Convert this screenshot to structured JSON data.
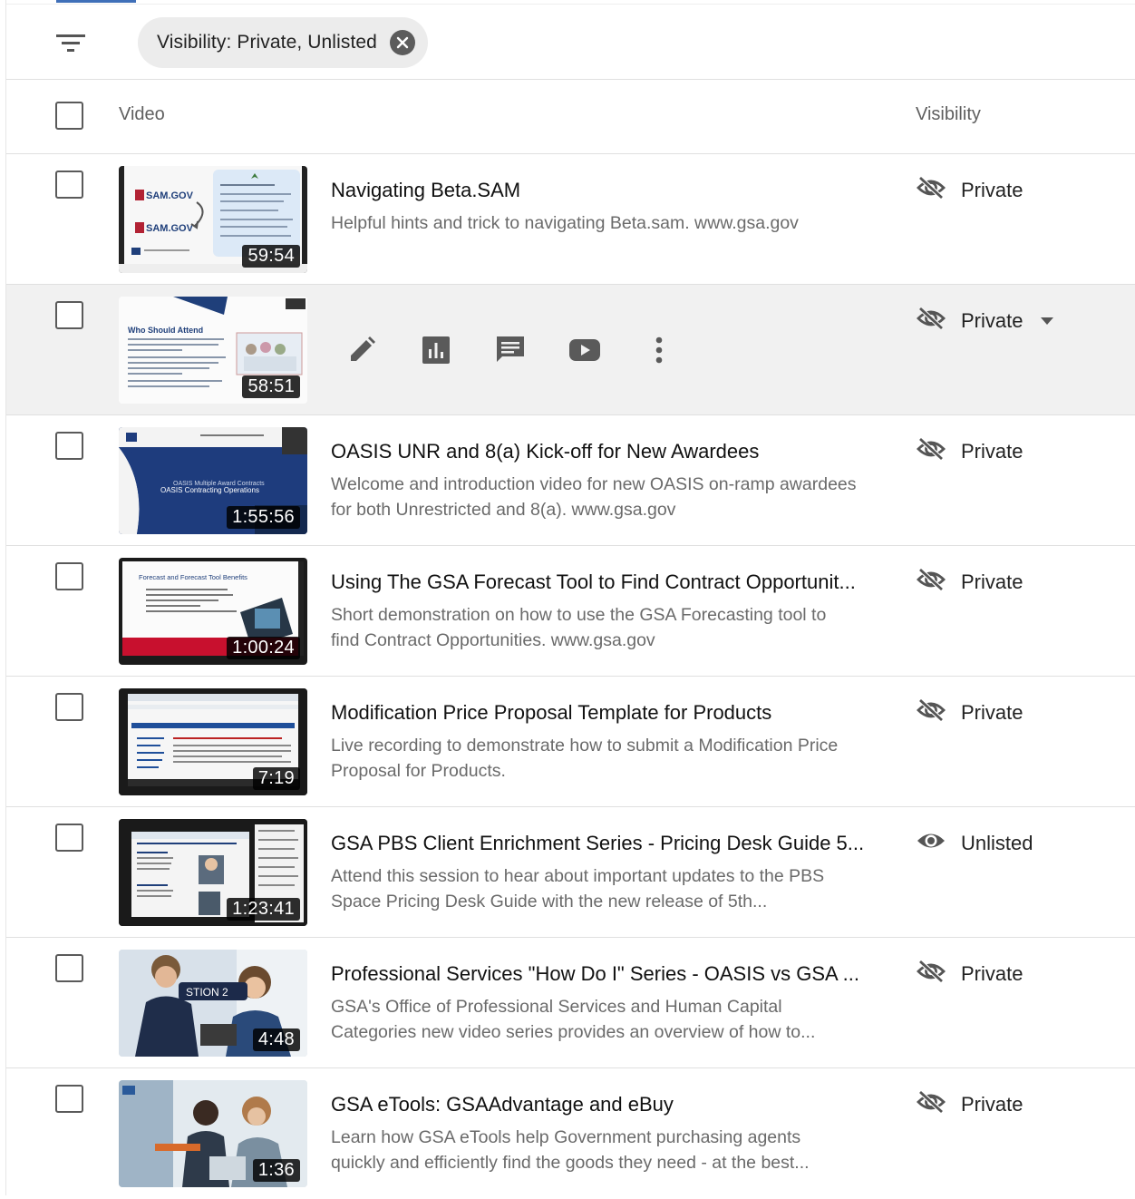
{
  "filter": {
    "chip_label": "Visibility: Private, Unlisted"
  },
  "header": {
    "video_col": "Video",
    "visibility_col": "Visibility"
  },
  "rows": [
    {
      "title": "Navigating Beta.SAM",
      "description": "Helpful hints and trick to navigating Beta.sam. www.gsa.gov",
      "duration": "59:54",
      "visibility": "Private",
      "thumb_text": [
        "SAM.GOV",
        "SAM.GOV"
      ]
    },
    {
      "title": "",
      "description": "",
      "duration": "58:51",
      "visibility": "Private",
      "thumb_text": [
        "Who Should Attend"
      ]
    },
    {
      "title": "OASIS UNR and 8(a) Kick-off for New Awardees",
      "description": "Welcome and introduction video for new OASIS on-ramp awardees for both Unrestricted and 8(a). www.gsa.gov",
      "duration": "1:55:56",
      "visibility": "Private",
      "thumb_text": [
        "OASIS Contracting Operations"
      ]
    },
    {
      "title": "Using The GSA Forecast Tool to Find Contract Opportunit...",
      "description": "Short demonstration on how to use the GSA Forecasting tool to find Contract Opportunities. www.gsa.gov",
      "duration": "1:00:24",
      "visibility": "Private",
      "thumb_text": [
        "Forecast and Forecast Tool Benefits"
      ]
    },
    {
      "title": "Modification Price Proposal Template for Products",
      "description": "Live recording to demonstrate how to submit a Modification Price Proposal for Products.",
      "duration": "7:19",
      "visibility": "Private",
      "thumb_text": []
    },
    {
      "title": "GSA PBS Client Enrichment Series - Pricing Desk Guide 5...",
      "description": "Attend this session to hear about important updates to the PBS Space Pricing Desk Guide with the new release of 5th...",
      "duration": "1:23:41",
      "visibility": "Unlisted",
      "thumb_text": []
    },
    {
      "title": "Professional Services \"How Do I\" Series - OASIS vs GSA ...",
      "description": "GSA's Office of Professional Services and Human Capital Categories new video series provides an overview of how to...",
      "duration": "4:48",
      "visibility": "Private",
      "thumb_text": [
        "STION 2"
      ]
    },
    {
      "title": "GSA eTools: GSAAdvantage and eBuy",
      "description": "Learn how GSA eTools help Government purchasing agents quickly and efficiently find the goods they need - at the best...",
      "duration": "1:36",
      "visibility": "Private",
      "thumb_text": []
    }
  ],
  "icons": {
    "filter": "filter-list-icon",
    "chip_close": "close-circle-icon",
    "private": "visibility-off-icon",
    "unlisted": "eye-icon",
    "row_actions": [
      "pencil-icon",
      "analytics-icon",
      "comments-icon",
      "youtube-play-icon",
      "more-vert-icon"
    ]
  },
  "colors": {
    "accent_tab": "#3f6fb8",
    "hover_row": "#f1f1f1",
    "chip_bg": "#ececec"
  }
}
